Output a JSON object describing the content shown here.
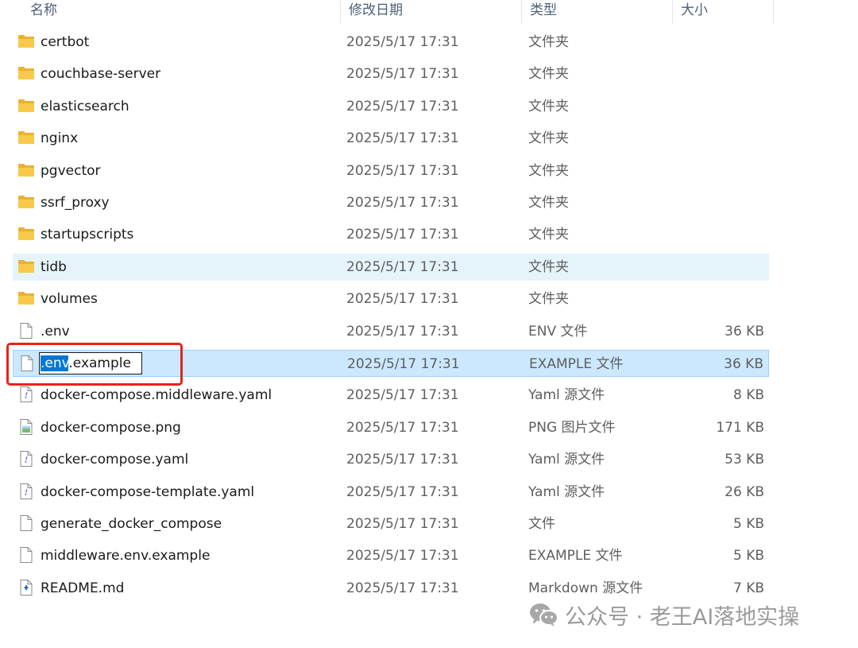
{
  "columns": {
    "name": "名称",
    "date": "修改日期",
    "type": "类型",
    "size": "大小"
  },
  "rows": [
    {
      "name": "certbot",
      "date": "2025/5/17 17:31",
      "type": "文件夹",
      "size": "",
      "icon": "folder-icon"
    },
    {
      "name": "couchbase-server",
      "date": "2025/5/17 17:31",
      "type": "文件夹",
      "size": "",
      "icon": "folder-icon"
    },
    {
      "name": "elasticsearch",
      "date": "2025/5/17 17:31",
      "type": "文件夹",
      "size": "",
      "icon": "folder-icon"
    },
    {
      "name": "nginx",
      "date": "2025/5/17 17:31",
      "type": "文件夹",
      "size": "",
      "icon": "folder-icon"
    },
    {
      "name": "pgvector",
      "date": "2025/5/17 17:31",
      "type": "文件夹",
      "size": "",
      "icon": "folder-icon"
    },
    {
      "name": "ssrf_proxy",
      "date": "2025/5/17 17:31",
      "type": "文件夹",
      "size": "",
      "icon": "folder-icon"
    },
    {
      "name": "startupscripts",
      "date": "2025/5/17 17:31",
      "type": "文件夹",
      "size": "",
      "icon": "folder-icon"
    },
    {
      "name": "tidb",
      "date": "2025/5/17 17:31",
      "type": "文件夹",
      "size": "",
      "icon": "folder-icon",
      "state": "hover"
    },
    {
      "name": "volumes",
      "date": "2025/5/17 17:31",
      "type": "文件夹",
      "size": "",
      "icon": "folder-icon"
    },
    {
      "name": ".env",
      "date": "2025/5/17 17:31",
      "type": "ENV 文件",
      "size": "36 KB",
      "icon": "file-icon"
    },
    {
      "name": ".env.example",
      "date": "2025/5/17 17:31",
      "type": "EXAMPLE 文件",
      "size": "36 KB",
      "icon": "file-icon",
      "state": "selected",
      "rename_selected": ".env",
      "rename_rest": ".example"
    },
    {
      "name": "docker-compose.middleware.yaml",
      "date": "2025/5/17 17:31",
      "type": "Yaml 源文件",
      "size": "8 KB",
      "icon": "yaml-file-icon"
    },
    {
      "name": "docker-compose.png",
      "date": "2025/5/17 17:31",
      "type": "PNG 图片文件",
      "size": "171 KB",
      "icon": "image-file-icon"
    },
    {
      "name": "docker-compose.yaml",
      "date": "2025/5/17 17:31",
      "type": "Yaml 源文件",
      "size": "53 KB",
      "icon": "yaml-file-icon"
    },
    {
      "name": "docker-compose-template.yaml",
      "date": "2025/5/17 17:31",
      "type": "Yaml 源文件",
      "size": "26 KB",
      "icon": "yaml-file-icon"
    },
    {
      "name": "generate_docker_compose",
      "date": "2025/5/17 17:31",
      "type": "文件",
      "size": "5 KB",
      "icon": "file-icon"
    },
    {
      "name": "middleware.env.example",
      "date": "2025/5/17 17:31",
      "type": "EXAMPLE 文件",
      "size": "5 KB",
      "icon": "file-icon"
    },
    {
      "name": "README.md",
      "date": "2025/5/17 17:31",
      "type": "Markdown 源文件",
      "size": "7 KB",
      "icon": "markdown-file-icon"
    }
  ],
  "watermark": {
    "icon": "wechat-icon",
    "text": "公众号 · 老王AI落地实操"
  },
  "colors": {
    "selected_bg": "#cce8ff",
    "selected_border": "#99d1ff",
    "hover_bg": "#e5f3fb",
    "highlight_frame": "#e8231a",
    "folder": "#f8c94a",
    "text_selection": "#0078d7"
  }
}
